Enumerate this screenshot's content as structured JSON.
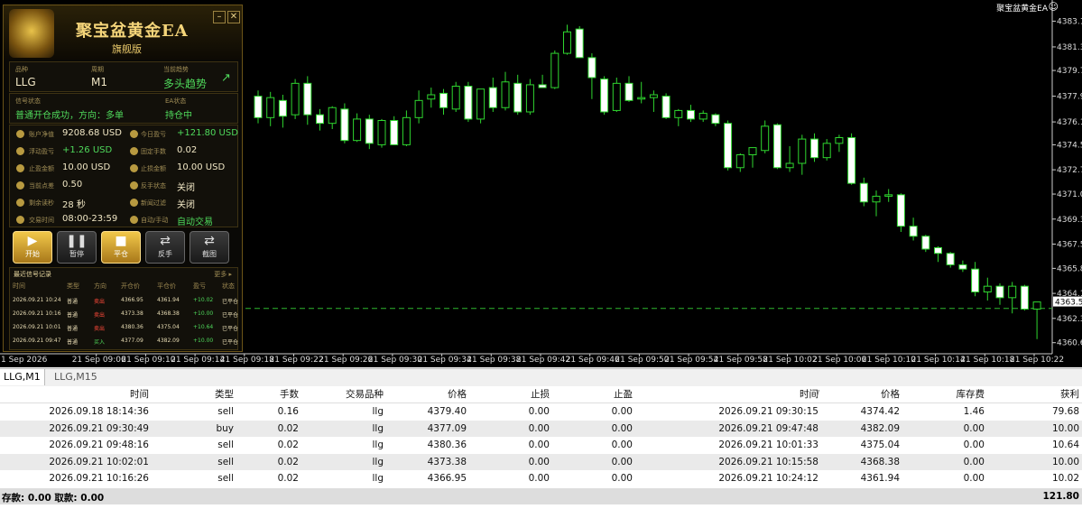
{
  "chart_overlay_label": "聚宝盆黄金EA",
  "y_axis": {
    "min": 4360.0,
    "max": 4384.0,
    "ticks": [
      "4383.15",
      "4381.35",
      "4379.70",
      "4377.90",
      "4376.10",
      "4374.50",
      "4372.75",
      "4371.05",
      "4369.30",
      "4367.55",
      "4365.85",
      "4364.10",
      "4362.35",
      "4360.65"
    ],
    "tick_values": [
      4383.15,
      4381.35,
      4379.7,
      4377.9,
      4376.1,
      4374.5,
      4372.75,
      4371.05,
      4369.3,
      4367.55,
      4365.85,
      4364.1,
      4362.35,
      4360.65
    ],
    "current_price": "4363.50",
    "current_value": 4363.5,
    "ask_value": 4363.05
  },
  "x_axis": {
    "ticks": [
      "1 Sep 2026",
      "21 Sep 09:06",
      "21 Sep 09:10",
      "21 Sep 09:14",
      "21 Sep 09:18",
      "21 Sep 09:22",
      "21 Sep 09:26",
      "21 Sep 09:30",
      "21 Sep 09:34",
      "21 Sep 09:38",
      "21 Sep 09:42",
      "21 Sep 09:46",
      "21 Sep 09:50",
      "21 Sep 09:54",
      "21 Sep 09:58",
      "21 Sep 10:02",
      "21 Sep 10:06",
      "21 Sep 10:10",
      "21 Sep 10:14",
      "21 Sep 10:18",
      "21 Sep 10:22"
    ]
  },
  "chart_data": {
    "type": "candlestick",
    "candles": [
      {
        "o": 4377.9,
        "h": 4378.3,
        "l": 4376.0,
        "c": 4376.4
      },
      {
        "o": 4376.4,
        "h": 4378.2,
        "l": 4375.8,
        "c": 4377.8
      },
      {
        "o": 4377.6,
        "h": 4378.0,
        "l": 4375.7,
        "c": 4376.5
      },
      {
        "o": 4376.6,
        "h": 4379.1,
        "l": 4376.3,
        "c": 4378.8
      },
      {
        "o": 4378.8,
        "h": 4379.3,
        "l": 4375.9,
        "c": 4376.6
      },
      {
        "o": 4376.6,
        "h": 4377.0,
        "l": 4375.5,
        "c": 4376.0
      },
      {
        "o": 4376.0,
        "h": 4377.2,
        "l": 4375.6,
        "c": 4377.1
      },
      {
        "o": 4377.0,
        "h": 4377.4,
        "l": 4374.6,
        "c": 4374.8
      },
      {
        "o": 4374.8,
        "h": 4376.7,
        "l": 4374.7,
        "c": 4376.3
      },
      {
        "o": 4376.3,
        "h": 4376.6,
        "l": 4374.2,
        "c": 4374.6
      },
      {
        "o": 4374.5,
        "h": 4376.3,
        "l": 4374.3,
        "c": 4376.2
      },
      {
        "o": 4376.2,
        "h": 4376.5,
        "l": 4374.5,
        "c": 4374.5
      },
      {
        "o": 4374.5,
        "h": 4376.9,
        "l": 4374.4,
        "c": 4376.4
      },
      {
        "o": 4376.4,
        "h": 4378.3,
        "l": 4376.0,
        "c": 4377.6
      },
      {
        "o": 4377.7,
        "h": 4378.5,
        "l": 4377.1,
        "c": 4378.0
      },
      {
        "o": 4378.1,
        "h": 4378.4,
        "l": 4376.6,
        "c": 4377.1
      },
      {
        "o": 4377.0,
        "h": 4378.9,
        "l": 4376.8,
        "c": 4378.6
      },
      {
        "o": 4378.6,
        "h": 4378.9,
        "l": 4376.1,
        "c": 4376.3
      },
      {
        "o": 4376.3,
        "h": 4378.4,
        "l": 4376.0,
        "c": 4378.4
      },
      {
        "o": 4378.5,
        "h": 4379.2,
        "l": 4376.8,
        "c": 4377.1
      },
      {
        "o": 4377.1,
        "h": 4379.6,
        "l": 4376.9,
        "c": 4378.9
      },
      {
        "o": 4378.8,
        "h": 4379.4,
        "l": 4376.6,
        "c": 4376.8
      },
      {
        "o": 4376.8,
        "h": 4379.1,
        "l": 4376.6,
        "c": 4378.7
      },
      {
        "o": 4378.7,
        "h": 4379.4,
        "l": 4378.5,
        "c": 4378.5
      },
      {
        "o": 4378.5,
        "h": 4381.1,
        "l": 4378.4,
        "c": 4380.9
      },
      {
        "o": 4380.9,
        "h": 4382.9,
        "l": 4380.8,
        "c": 4382.4
      },
      {
        "o": 4382.6,
        "h": 4382.8,
        "l": 4380.6,
        "c": 4380.6
      },
      {
        "o": 4380.6,
        "h": 4380.9,
        "l": 4377.7,
        "c": 4379.2
      },
      {
        "o": 4379.1,
        "h": 4379.3,
        "l": 4376.6,
        "c": 4376.8
      },
      {
        "o": 4376.9,
        "h": 4379.2,
        "l": 4376.8,
        "c": 4378.8
      },
      {
        "o": 4378.8,
        "h": 4379.3,
        "l": 4377.5,
        "c": 4377.6
      },
      {
        "o": 4377.7,
        "h": 4378.9,
        "l": 4377.4,
        "c": 4377.8
      },
      {
        "o": 4377.8,
        "h": 4378.3,
        "l": 4376.8,
        "c": 4378.0
      },
      {
        "o": 4377.9,
        "h": 4378.1,
        "l": 4376.3,
        "c": 4376.4
      },
      {
        "o": 4376.4,
        "h": 4377.0,
        "l": 4375.8,
        "c": 4376.9
      },
      {
        "o": 4376.9,
        "h": 4377.3,
        "l": 4376.1,
        "c": 4376.3
      },
      {
        "o": 4376.3,
        "h": 4376.9,
        "l": 4376.1,
        "c": 4376.7
      },
      {
        "o": 4376.6,
        "h": 4376.7,
        "l": 4375.8,
        "c": 4376.0
      },
      {
        "o": 4376.0,
        "h": 4376.2,
        "l": 4372.7,
        "c": 4372.9
      },
      {
        "o": 4372.9,
        "h": 4373.9,
        "l": 4372.6,
        "c": 4373.8
      },
      {
        "o": 4373.8,
        "h": 4374.3,
        "l": 4372.9,
        "c": 4374.3
      },
      {
        "o": 4374.1,
        "h": 4376.2,
        "l": 4373.9,
        "c": 4375.8
      },
      {
        "o": 4375.9,
        "h": 4376.0,
        "l": 4372.8,
        "c": 4372.9
      },
      {
        "o": 4372.9,
        "h": 4374.4,
        "l": 4372.6,
        "c": 4373.2
      },
      {
        "o": 4373.2,
        "h": 4375.2,
        "l": 4372.4,
        "c": 4374.9
      },
      {
        "o": 4374.9,
        "h": 4375.3,
        "l": 4373.3,
        "c": 4373.6
      },
      {
        "o": 4373.6,
        "h": 4374.9,
        "l": 4373.4,
        "c": 4374.6
      },
      {
        "o": 4374.6,
        "h": 4375.2,
        "l": 4374.0,
        "c": 4375.0
      },
      {
        "o": 4375.0,
        "h": 4375.3,
        "l": 4371.7,
        "c": 4371.8
      },
      {
        "o": 4371.8,
        "h": 4372.2,
        "l": 4370.2,
        "c": 4370.5
      },
      {
        "o": 4370.5,
        "h": 4371.3,
        "l": 4369.5,
        "c": 4370.9
      },
      {
        "o": 4370.9,
        "h": 4371.4,
        "l": 4370.5,
        "c": 4371.0
      },
      {
        "o": 4371.0,
        "h": 4371.1,
        "l": 4368.4,
        "c": 4368.8
      },
      {
        "o": 4368.8,
        "h": 4369.4,
        "l": 4367.8,
        "c": 4368.1
      },
      {
        "o": 4368.1,
        "h": 4368.2,
        "l": 4367.0,
        "c": 4367.2
      },
      {
        "o": 4367.3,
        "h": 4367.4,
        "l": 4366.3,
        "c": 4366.9
      },
      {
        "o": 4366.9,
        "h": 4367.0,
        "l": 4365.9,
        "c": 4366.1
      },
      {
        "o": 4366.1,
        "h": 4366.4,
        "l": 4365.6,
        "c": 4365.8
      },
      {
        "o": 4365.8,
        "h": 4366.3,
        "l": 4363.9,
        "c": 4364.2
      },
      {
        "o": 4364.2,
        "h": 4365.2,
        "l": 4363.6,
        "c": 4364.6
      },
      {
        "o": 4364.6,
        "h": 4364.8,
        "l": 4363.3,
        "c": 4363.8
      },
      {
        "o": 4363.8,
        "h": 4364.9,
        "l": 4362.7,
        "c": 4364.6
      },
      {
        "o": 4364.6,
        "h": 4364.7,
        "l": 4362.9,
        "c": 4363.0
      },
      {
        "o": 4363.0,
        "h": 4363.5,
        "l": 4360.9,
        "c": 4363.5
      }
    ]
  },
  "panel": {
    "title": "聚宝盆黄金EA",
    "subtitle": "旗舰版",
    "min_btn": "–",
    "close_btn": "✕",
    "symbol_label": "品种",
    "symbol": "LLG",
    "period_label": "周期",
    "period": "M1",
    "trend_label": "当前趋势",
    "trend": "多头趋势",
    "signal_label": "信号状态",
    "signal": "普通开仓成功，方向：多单",
    "ea_status_label": "EA状态",
    "ea_status": "持仓中",
    "rows": [
      {
        "k1": "账户净值",
        "v1": "9208.68 USD",
        "k2": "今日盈亏",
        "v2": "+121.80 USD"
      },
      {
        "k1": "浮动盈亏",
        "v1": "+1.26 USD",
        "k2": "固定手数",
        "v2": "0.02"
      },
      {
        "k1": "止盈金额",
        "v1": "10.00 USD",
        "k2": "止损金额",
        "v2": "10.00 USD"
      },
      {
        "k1": "当前点差",
        "v1": "0.50",
        "k2": "反手状态",
        "v2": "关闭"
      },
      {
        "k1": "剩余读秒",
        "v1": "28 秒",
        "k2": "新闻过滤",
        "v2": "关闭"
      },
      {
        "k1": "交易时间",
        "v1": "08:00-23:59",
        "k2": "自动/手动",
        "v2": "自动交易"
      }
    ],
    "buttons": [
      {
        "icon": "▶",
        "label": "开始"
      },
      {
        "icon": "❚❚",
        "label": "暂停"
      },
      {
        "icon": "■",
        "label": "平仓"
      },
      {
        "icon": "⇄",
        "label": "反手"
      },
      {
        "icon": "⇄",
        "label": "截图"
      }
    ],
    "signals_title": "最近信号记录",
    "signals_more": "更多 ▸",
    "signals_headers": [
      "时间",
      "类型",
      "方向",
      "开仓价",
      "平仓价",
      "盈亏",
      "状态"
    ],
    "signals": [
      [
        "2026.09.21 10:24",
        "普通",
        "卖出",
        "4366.95",
        "4361.94",
        "+10.02",
        "已平仓"
      ],
      [
        "2026.09.21 10:16",
        "普通",
        "卖出",
        "4373.38",
        "4368.38",
        "+10.00",
        "已平仓"
      ],
      [
        "2026.09.21 10:01",
        "普通",
        "卖出",
        "4380.36",
        "4375.04",
        "+10.64",
        "已平仓"
      ],
      [
        "2026.09.21 09:47",
        "普通",
        "买入",
        "4377.09",
        "4382.09",
        "+10.00",
        "已平仓"
      ]
    ]
  },
  "tabs": [
    "LLG,M1",
    "LLG,M15"
  ],
  "table": {
    "headers": [
      "时间",
      "类型",
      "手数",
      "交易品种",
      "价格",
      "止损",
      "止盈",
      "时间",
      "价格",
      "库存费",
      "获利"
    ],
    "sort_indicator": "/",
    "rows": [
      [
        "2026.09.18 18:14:36",
        "sell",
        "0.16",
        "llg",
        "4379.40",
        "0.00",
        "0.00",
        "2026.09.21 09:30:15",
        "4374.42",
        "1.46",
        "79.68"
      ],
      [
        "2026.09.21 09:30:49",
        "buy",
        "0.02",
        "llg",
        "4377.09",
        "0.00",
        "0.00",
        "2026.09.21 09:47:48",
        "4382.09",
        "0.00",
        "10.00"
      ],
      [
        "2026.09.21 09:48:16",
        "sell",
        "0.02",
        "llg",
        "4380.36",
        "0.00",
        "0.00",
        "2026.09.21 10:01:33",
        "4375.04",
        "0.00",
        "10.64"
      ],
      [
        "2026.09.21 10:02:01",
        "sell",
        "0.02",
        "llg",
        "4373.38",
        "0.00",
        "0.00",
        "2026.09.21 10:15:58",
        "4368.38",
        "0.00",
        "10.00"
      ],
      [
        "2026.09.21 10:16:26",
        "sell",
        "0.02",
        "llg",
        "4366.95",
        "0.00",
        "0.00",
        "2026.09.21 10:24:12",
        "4361.94",
        "0.00",
        "10.02"
      ]
    ],
    "footer_left": "存款: 0.00  取款: 0.00",
    "footer_total": "121.80"
  }
}
